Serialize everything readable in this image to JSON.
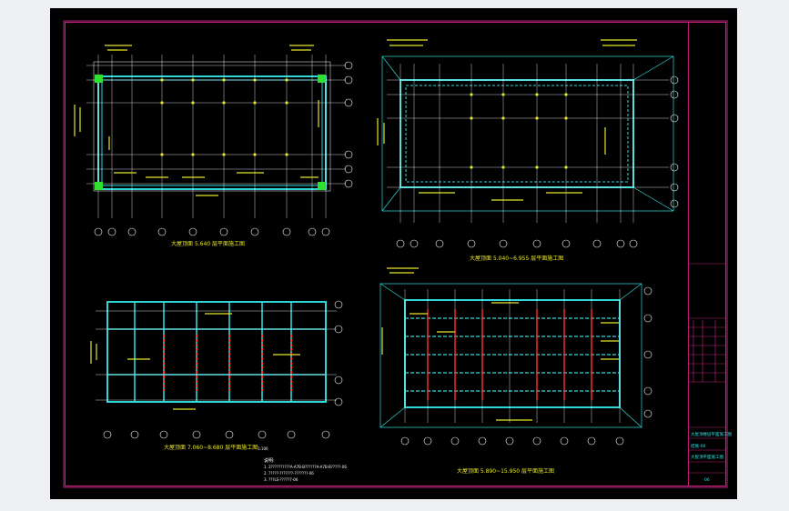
{
  "drawing": {
    "plan_titles": [
      "大屋顶面 5.640 层平面施工图",
      "大屋顶面 5.040~6.955 层平面施工图",
      "大屋顶面 7.060~8.680 层平面施工图",
      "大屋顶面 5.890~15.950 层平面施工图"
    ],
    "scale_label": "1:100",
    "axis_labels_top": [
      "1",
      "2",
      "3",
      "4",
      "5",
      "6",
      "7",
      "8",
      "9",
      "10"
    ],
    "axis_labels_side": [
      "A",
      "B",
      "C",
      "D",
      "E"
    ],
    "notes_heading": "说明:",
    "notes": [
      "1. 2??????????A-A7B-B??????A-A7B-B?????-06",
      "2. ?????-???????-???????-06",
      "3. ???LS-?????7-06"
    ],
    "title_block": {
      "rows": [
        "",
        "",
        "",
        "",
        "",
        "",
        ""
      ],
      "project_label": "大屋顶楼层平面施工图",
      "sheet_label": "结施-06",
      "drawing_no": "大屋顶平面施工图",
      "page": "06"
    }
  },
  "colors": {
    "background": "#000000",
    "frame": "#c0207a",
    "beam": "#2fd6d6",
    "text": "#e6e62a",
    "white": "#ffffff",
    "red": "#ff3030",
    "green": "#30e030"
  }
}
